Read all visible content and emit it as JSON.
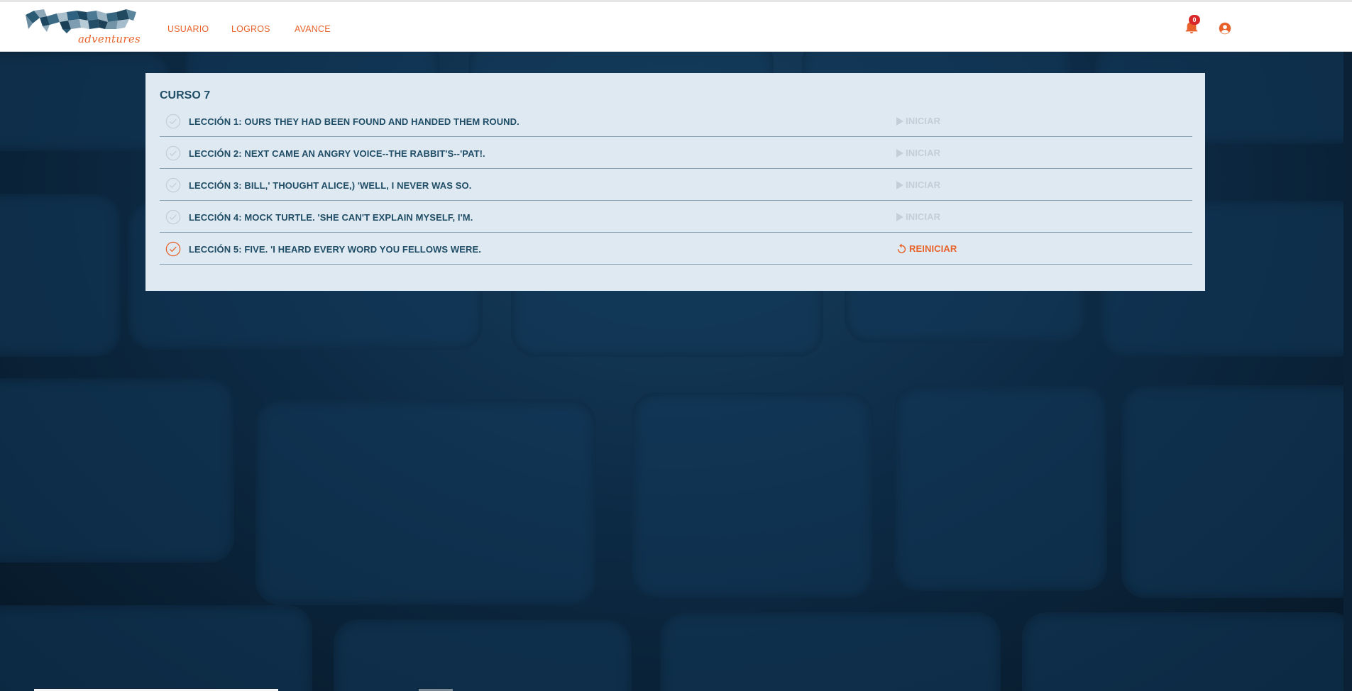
{
  "header": {
    "logo_text": "adventures",
    "nav": [
      {
        "label": "USUARIO"
      },
      {
        "label": "LOGROS"
      },
      {
        "label": "AVANCE"
      }
    ],
    "notifications_count": "0",
    "icons": {
      "bell": "bell-icon",
      "user": "user-circle-icon"
    }
  },
  "course": {
    "title": "CURSO 7",
    "lessons": [
      {
        "title": "LECCIÓN 1: OURS THEY HAD BEEN FOUND AND HANDED THEM ROUND.",
        "action": "INICIAR",
        "completed": false
      },
      {
        "title": "LECCIÓN 2: NEXT CAME AN ANGRY VOICE--THE RABBIT'S--'PAT!.",
        "action": "INICIAR",
        "completed": false
      },
      {
        "title": "LECCIÓN 3: BILL,' THOUGHT ALICE,) 'WELL, I NEVER WAS SO.",
        "action": "INICIAR",
        "completed": false
      },
      {
        "title": "LECCIÓN 4: MOCK TURTLE. 'SHE CAN'T EXPLAIN MYSELF, I'M.",
        "action": "INICIAR",
        "completed": false
      },
      {
        "title": "LECCIÓN 5: FIVE. 'I HEARD EVERY WORD YOU FELLOWS WERE.",
        "action": "REINICIAR",
        "completed": true
      }
    ]
  },
  "colors": {
    "accent": "#e8632b",
    "text_dark": "#1f4d66",
    "panel_bg": "#dfe9f2",
    "disabled": "#c3ced8",
    "badge": "#d9282a"
  }
}
